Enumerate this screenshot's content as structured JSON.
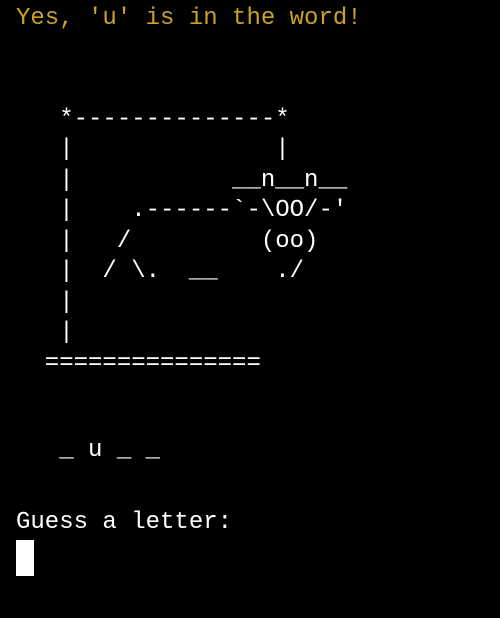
{
  "status_message": "Yes, 'u' is in the word!",
  "hangman_art": "\n   *--------------*\n   |              |\n   |           __n__n__\n   |    .------`-\\OO/-'\n   |   /         (oo)\n   |  / \\.  __    ./\n   |\n   |\n  ===============",
  "word_display": "   _ u _ _",
  "input_prompt": "Guess a letter:",
  "colors": {
    "background": "#000000",
    "status_text": "#c9a227",
    "text": "#ffffff"
  }
}
